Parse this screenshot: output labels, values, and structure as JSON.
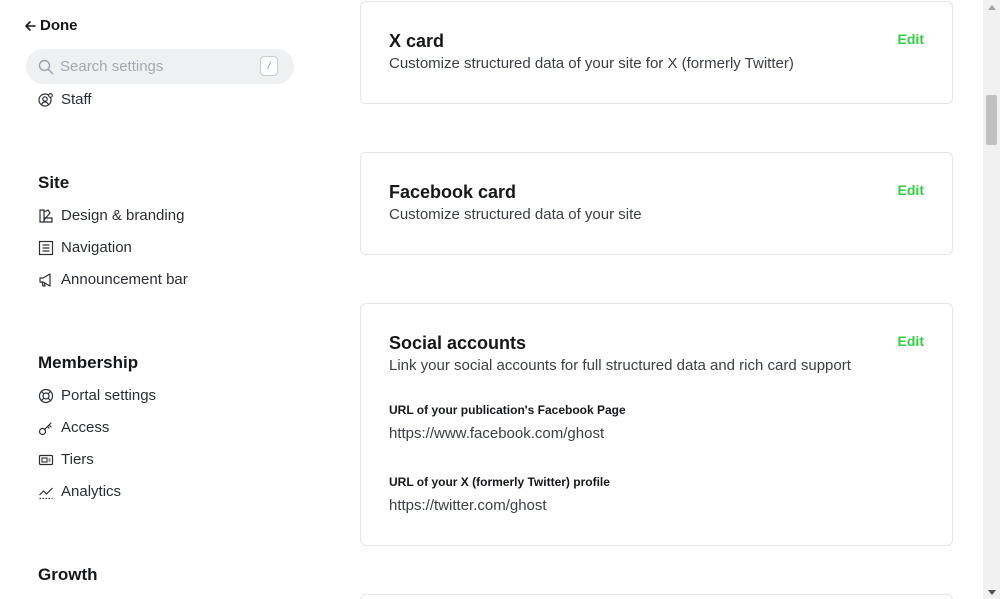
{
  "header": {
    "done_label": "Done"
  },
  "search": {
    "placeholder": "Search settings",
    "shortcut": "/"
  },
  "sidebar": {
    "staff_label": "Staff",
    "site_title": "Site",
    "site_items": [
      "Design & branding",
      "Navigation",
      "Announcement bar"
    ],
    "membership_title": "Membership",
    "membership_items": [
      "Portal settings",
      "Access",
      "Tiers",
      "Analytics"
    ],
    "growth_title": "Growth"
  },
  "cards": {
    "x_card": {
      "title": "X card",
      "description": "Customize structured data of your site for X (formerly Twitter)",
      "edit_label": "Edit"
    },
    "facebook_card": {
      "title": "Facebook card",
      "description": "Customize structured data of your site",
      "edit_label": "Edit"
    },
    "social_accounts": {
      "title": "Social accounts",
      "description": "Link your social accounts for full structured data and rich card support",
      "edit_label": "Edit",
      "facebook_label": "URL of your publication's Facebook Page",
      "facebook_value": "https://www.facebook.com/ghost",
      "twitter_label": "URL of your X (formerly Twitter) profile",
      "twitter_value": "https://twitter.com/ghost"
    }
  },
  "colors": {
    "accent": "#30cf43",
    "text": "#15171a",
    "border": "#e3e6ea",
    "search_bg": "#eff0f1"
  }
}
